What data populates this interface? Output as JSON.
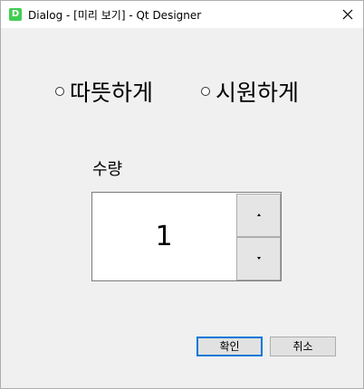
{
  "window": {
    "title": "Dialog - [미리 보기] - Qt Designer",
    "app_icon_letter": "D",
    "icons": {
      "app": "qt-designer-app-icon",
      "close": "close-icon"
    }
  },
  "radios": [
    {
      "label": "따뜻하게",
      "checked": false
    },
    {
      "label": "시원하게",
      "checked": false
    }
  ],
  "quantity": {
    "label": "수량",
    "value": "1",
    "up_icon": "chevron-up-icon",
    "down_icon": "chevron-down-icon"
  },
  "buttons": {
    "ok_label": "확인",
    "cancel_label": "취소"
  },
  "colors": {
    "focus_accent": "#0078d7",
    "qt_green": "#41cd52",
    "dialog_bg": "#f0f0f0"
  }
}
